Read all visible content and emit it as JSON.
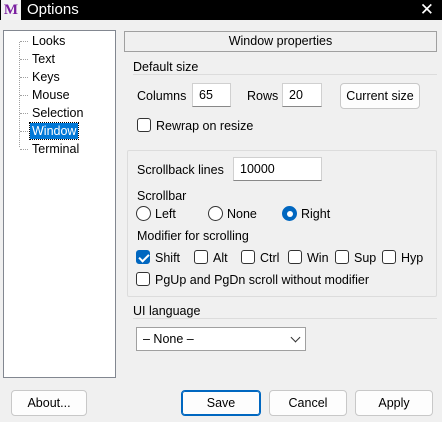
{
  "window": {
    "title": "Options",
    "app_icon_letter": "M",
    "close_glyph": "✕"
  },
  "tree": {
    "items": [
      {
        "label": "Looks",
        "selected": false
      },
      {
        "label": "Text",
        "selected": false
      },
      {
        "label": "Keys",
        "selected": false
      },
      {
        "label": "Mouse",
        "selected": false
      },
      {
        "label": "Selection",
        "selected": false
      },
      {
        "label": "Window",
        "selected": true
      },
      {
        "label": "Terminal",
        "selected": false
      }
    ]
  },
  "pane": {
    "header": "Window properties"
  },
  "default_size": {
    "group_label": "Default size",
    "columns_label": "Columns",
    "columns_value": "65",
    "rows_label": "Rows",
    "rows_value": "20",
    "current_size_button": "Current size",
    "rewrap_label": "Rewrap on resize",
    "rewrap_checked": false
  },
  "scrolling": {
    "scrollback_label": "Scrollback lines",
    "scrollback_value": "10000",
    "scrollbar_label": "Scrollbar",
    "scrollbar_options": [
      "Left",
      "None",
      "Right"
    ],
    "scrollbar_selected": "Right",
    "modifier_label": "Modifier for scrolling",
    "modifiers": [
      {
        "label": "Shift",
        "checked": true
      },
      {
        "label": "Alt",
        "checked": false
      },
      {
        "label": "Ctrl",
        "checked": false
      },
      {
        "label": "Win",
        "checked": false
      },
      {
        "label": "Sup",
        "checked": false
      },
      {
        "label": "Hyp",
        "checked": false
      }
    ],
    "pgup_label": "PgUp and PgDn scroll without modifier",
    "pgup_checked": false
  },
  "ui_language": {
    "group_label": "UI language",
    "selected": "– None –"
  },
  "buttons": {
    "about": "About...",
    "save": "Save",
    "cancel": "Cancel",
    "apply": "Apply"
  },
  "colors": {
    "accent": "#0067c0",
    "selection": "#0078d7",
    "titlebar": "#000000"
  }
}
